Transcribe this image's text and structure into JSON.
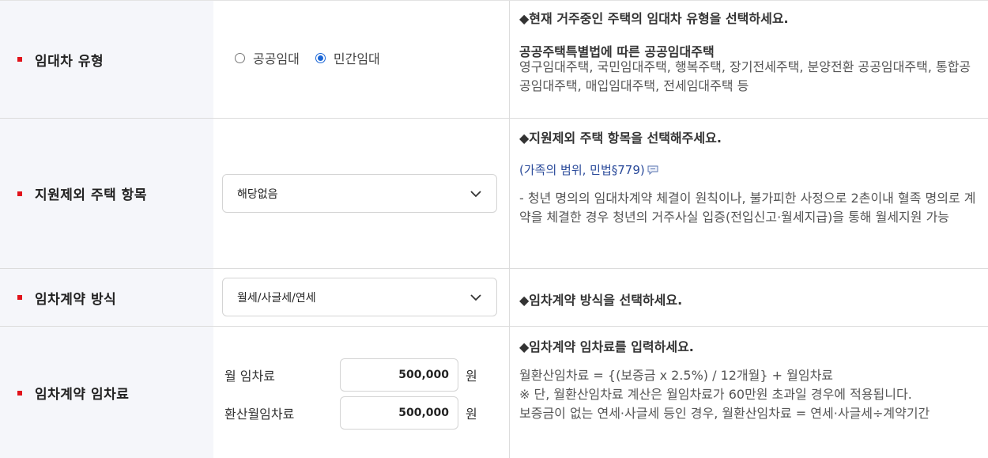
{
  "rows": {
    "lease_type": {
      "label": "임대차 유형",
      "options": [
        {
          "label": "공공임대",
          "checked": false
        },
        {
          "label": "민간임대",
          "checked": true
        }
      ],
      "desc_title": "◆현재 거주중인 주택의 임대차 유형을 선택하세요.",
      "desc_sub": "공공주택특별법에 따른 공공임대주택",
      "desc_text": "영구임대주택, 국민임대주택, 행복주택, 장기전세주택, 분양전환 공공임대주택, 통합공공임대주택, 매입임대주택, 전세임대주택 등"
    },
    "excluded_housing": {
      "label": "지원제외 주택 항목",
      "select_value": "해당없음",
      "desc_title": "◆지원제외 주택 항목을 선택해주세요.",
      "desc_link": "(가족의 범위, 민법§779)",
      "desc_text": "- 청년 명의의 임대차계약 체결이 원칙이나, 불가피한 사정으로 2촌이내 혈족 명의로 계약을 체결한 경우 청년의 거주사실 입증(전입신고·월세지급)을 통해 월세지원 가능"
    },
    "contract_method": {
      "label": "임차계약 방식",
      "select_value": "월세/사글세/연세",
      "desc_title": "◆임차계약 방식을 선택하세요."
    },
    "rent": {
      "label": "임차계약 임차료",
      "monthly_label": "월 임차료",
      "monthly_value": "500,000",
      "converted_label": "환산월임차료",
      "converted_value": "500,000",
      "unit": "원",
      "desc_title": "◆임차계약 임차료를 입력하세요.",
      "desc_line1": "월환산임차료 = {(보증금 x 2.5%) / 12개월} + 월임차료",
      "desc_line2": "※ 단, 월환산임차료 계산은 월임차료가 60만원 초과일 경우에 적용됩니다.",
      "desc_line3": "보증금이 없는 연세·사글세 등인 경우, 월환산임차료 = 연세·사글세÷계약기간"
    }
  },
  "colors": {
    "required_mark": "#e1131b",
    "label_bg": "#f5f6fa",
    "radio_accent": "#1a66d6",
    "link": "#2a4a9a"
  },
  "icons": {
    "select_arrow": "chevron-down-icon",
    "link_tip": "speech-bubble-icon"
  }
}
